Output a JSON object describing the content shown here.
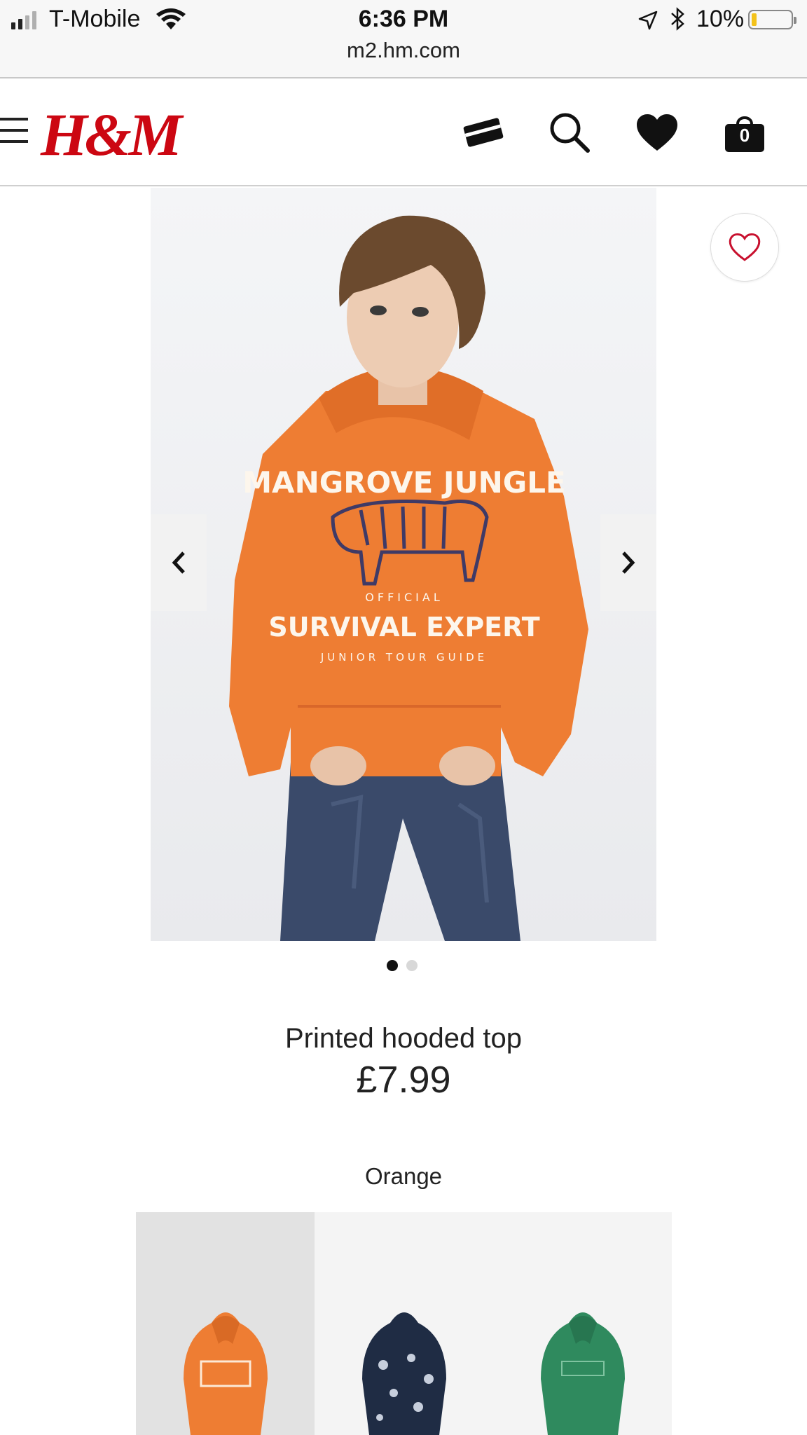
{
  "status_bar": {
    "carrier": "T-Mobile",
    "time": "6:36 PM",
    "url": "m2.hm.com",
    "battery": "10%",
    "battery_level": 0.1
  },
  "header": {
    "logo": "H&M",
    "cart_count": "0",
    "icons": [
      "menu-icon",
      "payment-card-icon",
      "search-icon",
      "heart-icon",
      "shopping-bag-icon"
    ]
  },
  "product": {
    "title": "Printed hooded top",
    "price": "£7.99",
    "image_count": 2,
    "active_image": 1,
    "color": "Orange",
    "colors": {
      "hoodie": "#ee7d33",
      "jeans": "#3a4a6a",
      "hair": "#6b4a2e"
    },
    "print": {
      "line1": "MANGROVE JUNGLE",
      "line2": "OFFICIAL",
      "line3": "SURVIVAL EXPERT",
      "line4": "JUNIOR TOUR GUIDE"
    },
    "swatches": [
      {
        "name": "orange",
        "color": "#ee7d33",
        "selected": true
      },
      {
        "name": "navy-animal-print",
        "color": "#1f2c44",
        "selected": false
      },
      {
        "name": "green",
        "color": "#2f8a5e",
        "selected": false
      }
    ]
  }
}
